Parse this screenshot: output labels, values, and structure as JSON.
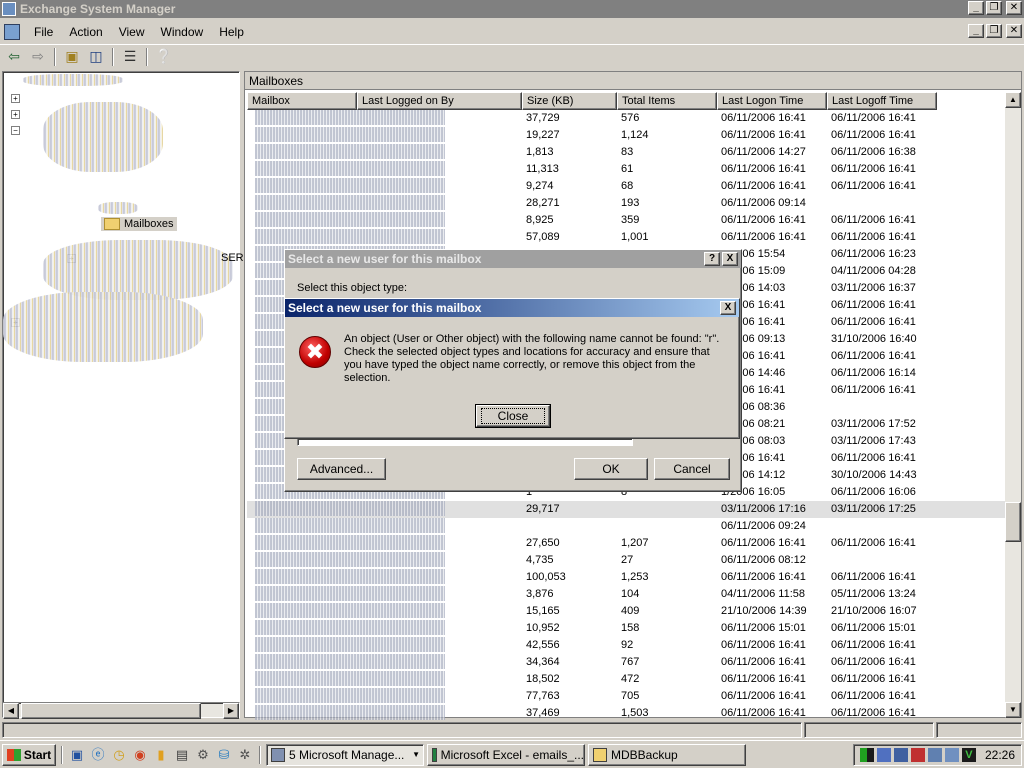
{
  "window": {
    "title": "Exchange System Manager"
  },
  "menu": [
    "File",
    "Action",
    "View",
    "Window",
    "Help"
  ],
  "tree": {
    "nodes": [
      "Mailboxes"
    ],
    "partial_label": "SER"
  },
  "pane": {
    "header": "Mailboxes",
    "columns": [
      "Mailbox",
      "Last Logged on By",
      "Size (KB)",
      "Total Items",
      "Last Logon Time",
      "Last Logoff Time"
    ],
    "rows": [
      [
        "37,729",
        "576",
        "06/11/2006 16:41",
        "06/11/2006 16:41"
      ],
      [
        "19,227",
        "1,124",
        "06/11/2006 16:41",
        "06/11/2006 16:41"
      ],
      [
        "1,813",
        "83",
        "06/11/2006 14:27",
        "06/11/2006 16:38"
      ],
      [
        "11,313",
        "61",
        "06/11/2006 16:41",
        "06/11/2006 16:41"
      ],
      [
        "9,274",
        "68",
        "06/11/2006 16:41",
        "06/11/2006 16:41"
      ],
      [
        "28,271",
        "193",
        "06/11/2006 09:14",
        ""
      ],
      [
        "8,925",
        "359",
        "06/11/2006 16:41",
        "06/11/2006 16:41"
      ],
      [
        "57,089",
        "1,001",
        "06/11/2006 16:41",
        "06/11/2006 16:41"
      ],
      [
        "",
        "",
        "1/2006 15:54",
        "06/11/2006 16:23"
      ],
      [
        "",
        "",
        "1/2006 15:09",
        "04/11/2006 04:28"
      ],
      [
        "",
        "",
        "1/2006 14:03",
        "03/11/2006 16:37"
      ],
      [
        "",
        "",
        "1/2006 16:41",
        "06/11/2006 16:41"
      ],
      [
        "",
        "",
        "1/2006 16:41",
        "06/11/2006 16:41"
      ],
      [
        "",
        "",
        "0/2006 09:13",
        "31/10/2006 16:40"
      ],
      [
        "",
        "",
        "1/2006 16:41",
        "06/11/2006 16:41"
      ],
      [
        "",
        "",
        "1/2006 14:46",
        "06/11/2006 16:14"
      ],
      [
        "",
        "",
        "1/2006 16:41",
        "06/11/2006 16:41"
      ],
      [
        "",
        "",
        "1/2006 08:36",
        ""
      ],
      [
        "",
        "",
        "1/2006 08:21",
        "03/11/2006 17:52"
      ],
      [
        "",
        "",
        "1/2006 08:03",
        "03/11/2006 17:43"
      ],
      [
        "",
        "",
        "1/2006 16:41",
        "06/11/2006 16:41"
      ],
      [
        "",
        "",
        "0/2006 14:12",
        "30/10/2006 14:43"
      ],
      [
        "1",
        "8",
        "1/2006 16:05",
        "06/11/2006 16:06"
      ],
      [
        "29,717",
        "",
        "03/11/2006 17:16",
        "03/11/2006 17:25"
      ],
      [
        "",
        "",
        "06/11/2006 09:24",
        ""
      ],
      [
        "27,650",
        "1,207",
        "06/11/2006 16:41",
        "06/11/2006 16:41"
      ],
      [
        "4,735",
        "27",
        "06/11/2006 08:12",
        ""
      ],
      [
        "100,053",
        "1,253",
        "06/11/2006 16:41",
        "06/11/2006 16:41"
      ],
      [
        "3,876",
        "104",
        "04/11/2006 11:58",
        "05/11/2006 13:24"
      ],
      [
        "15,165",
        "409",
        "21/10/2006 14:39",
        "21/10/2006 16:07"
      ],
      [
        "10,952",
        "158",
        "06/11/2006 15:01",
        "06/11/2006 15:01"
      ],
      [
        "42,556",
        "92",
        "06/11/2006 16:41",
        "06/11/2006 16:41"
      ],
      [
        "34,364",
        "767",
        "06/11/2006 16:41",
        "06/11/2006 16:41"
      ],
      [
        "18,502",
        "472",
        "06/11/2006 16:41",
        "06/11/2006 16:41"
      ],
      [
        "77,763",
        "705",
        "06/11/2006 16:41",
        "06/11/2006 16:41"
      ],
      [
        "37,469",
        "1,503",
        "06/11/2006 16:41",
        "06/11/2006 16:41"
      ]
    ]
  },
  "dialog_back": {
    "title": "Select a new user for this mailbox",
    "help_label": "?",
    "close_label": "X",
    "object_type_label": "Select this object type:",
    "advanced_label": "Advanced...",
    "ok_label": "OK",
    "cancel_label": "Cancel"
  },
  "dialog_error": {
    "title": "Select a new user for this mailbox",
    "close_label": "X",
    "icon_glyph": "✖",
    "message": "An object (User or Other object) with the following name cannot be found: \"r\". Check the selected object types and locations for accuracy and ensure that you have typed the object name correctly, or remove this object from the selection.",
    "button_label": "Close"
  },
  "taskbar": {
    "start_label": "Start",
    "tasks": [
      "5 Microsoft Manage...",
      "Microsoft Excel - emails_...",
      "MDBBackup"
    ],
    "clock": "22:26"
  }
}
